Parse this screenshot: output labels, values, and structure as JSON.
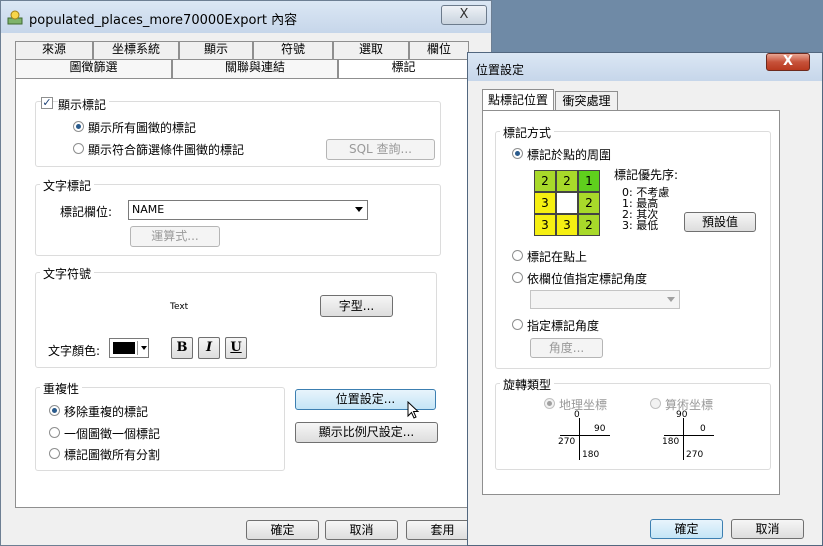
{
  "main_window": {
    "title": "populated_places_more70000Export  內容",
    "close": "X",
    "tabs_row1": [
      "來源",
      "坐標系統",
      "顯示",
      "符號",
      "選取",
      "欄位"
    ],
    "tabs_row2": [
      "圖徵篩選",
      "關聯與連結",
      "標記"
    ],
    "show_labels": "顯示標記",
    "radio_all": "顯示所有圖徵的標記",
    "radio_filtered": "顯示符合篩選條件圖徵的標記",
    "sql_button": "SQL 查詢...",
    "text_label_group": "文字標記",
    "label_field": "標記欄位:",
    "label_field_value": "NAME",
    "expression_button": "運算式...",
    "text_symbol_group": "文字符號",
    "preview_text": "Text",
    "font_button": "字型...",
    "text_color": "文字顏色:",
    "bold": "B",
    "italic": "I",
    "underline": "U",
    "duplicates_group": "重複性",
    "remove_dup": "移除重複的標記",
    "one_per_feature": "一個圖徵一個標記",
    "label_all_parts": "標記圖徵所有分割",
    "placement_button": "位置設定...",
    "scale_button": "顯示比例尺設定...",
    "ok": "確定",
    "cancel": "取消",
    "apply": "套用"
  },
  "placement_dialog": {
    "title": "位置設定",
    "close": "X",
    "tab_position": "點標記位置",
    "tab_conflict": "衝突處理",
    "method_group": "標記方式",
    "around_point": "標記於點的周圍",
    "priority_title": "標記優先序:",
    "priority_items": [
      "0: 不考慮",
      "1: 最高",
      "2: 其次",
      "3: 最低"
    ],
    "default_button": "預設值",
    "grid": [
      [
        "2",
        "2",
        "1"
      ],
      [
        "3",
        "",
        "2"
      ],
      [
        "3",
        "3",
        "2"
      ]
    ],
    "on_point": "標記在點上",
    "angle_by_field": "依欄位值指定標記角度",
    "specify_angle": "指定標記角度",
    "angle_button": "角度...",
    "rotation_group": "旋轉類型",
    "geographic": "地理坐標",
    "arithmetic": "算術坐標",
    "geo_axis": {
      "top": "0",
      "right": "90",
      "left": "270",
      "bottom": "180"
    },
    "arith_axis": {
      "top": "90",
      "right": "0",
      "left": "180",
      "bottom": "270"
    },
    "ok": "確定",
    "cancel": "取消"
  },
  "colors": {
    "grid_green": "#5fcf1d",
    "grid_lime": "#a8d92a",
    "grid_yellow": "#f5ef12"
  }
}
